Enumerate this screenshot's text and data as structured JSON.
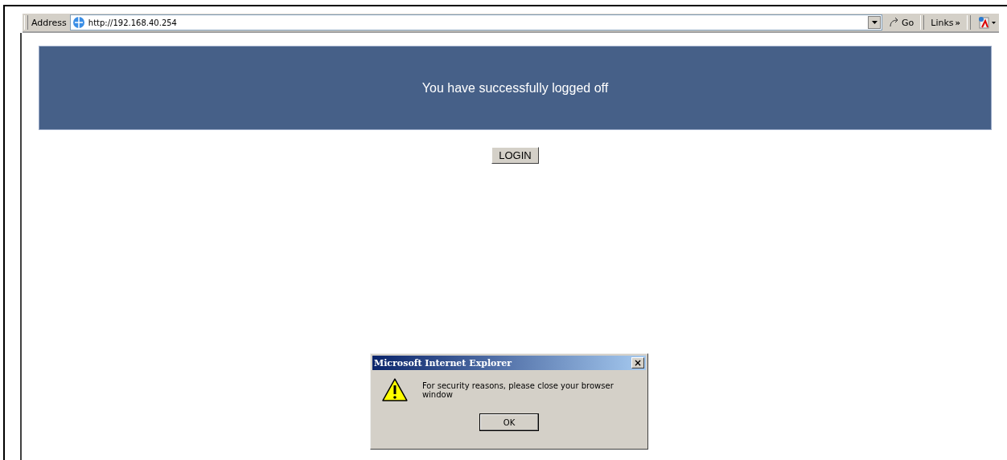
{
  "address_bar": {
    "label": "Address",
    "url": "http://192.168.40.254",
    "go": "Go",
    "links": "Links",
    "links_more": "»"
  },
  "banner": {
    "message": "You have successfully logged off"
  },
  "login_button": "LOGIN",
  "dialog": {
    "title": "Microsoft Internet Explorer",
    "close": "×",
    "message": "For security reasons, please close your browser window",
    "ok": "OK"
  }
}
